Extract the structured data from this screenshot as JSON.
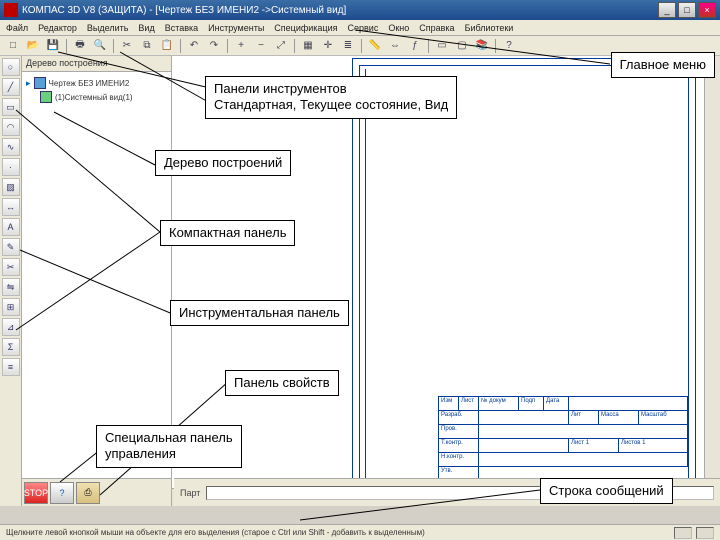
{
  "titlebar": {
    "text": "КОМПАС 3D V8 (ЗАЩИТА) - [Чертеж БЕЗ ИМЕНИ2 ->Системный вид]"
  },
  "menu": {
    "items": [
      "Файл",
      "Редактор",
      "Выделить",
      "Вид",
      "Вставка",
      "Инструменты",
      "Спецификация",
      "Сервис",
      "Окно",
      "Справка",
      "Библиотеки"
    ]
  },
  "tree": {
    "header": "Дерево построения",
    "root": "Чертеж БЕЗ ИМЕНИ2",
    "child": "(1)Системный вид(1)"
  },
  "propsbar": {
    "label": "Парт"
  },
  "statusbar": {
    "text": "Щелкните левой кнопкой мыши на объекте для его выделения (старое с Ctrl или Shift - добавить к выделенным)"
  },
  "callouts": {
    "mainmenu": "Главное меню",
    "toolbars": "Панели инструментов\nСтандартная, Текущее состояние, Вид",
    "tree": "Дерево построений",
    "compact": "Компактная панель",
    "toolpanel": "Инструментальная панель",
    "props": "Панель свойств",
    "special": "Специальная панель\nуправления",
    "status": "Строка сообщений"
  },
  "stamp": {
    "r1": [
      "Изм",
      "Лист",
      "№ докум",
      "Подп",
      "Дата",
      "Лит",
      "Масса",
      "Масштаб"
    ],
    "r2": [
      "Разраб."
    ],
    "r3": [
      "Пров."
    ],
    "r4": [
      "Т.контр."
    ],
    "r5": [
      "Н.контр."
    ],
    "r6": [
      "Утв."
    ],
    "r_sheet": [
      "Лист 1",
      "Листов 1"
    ]
  }
}
